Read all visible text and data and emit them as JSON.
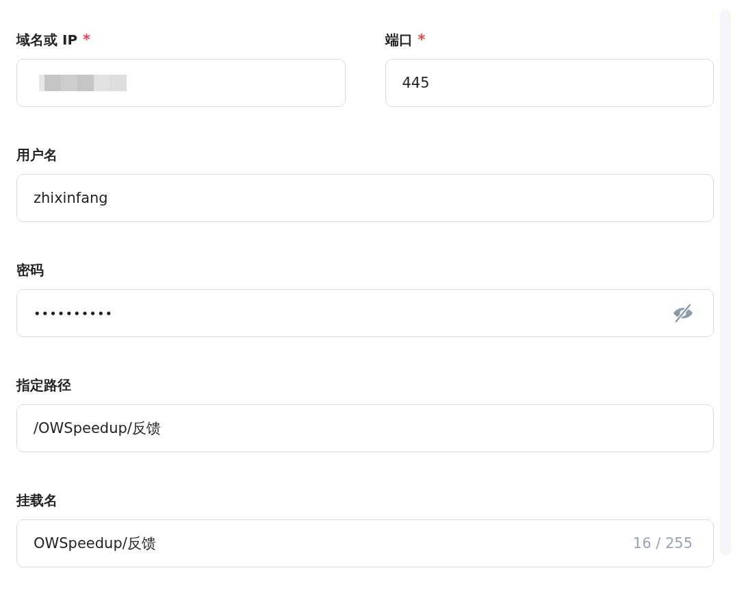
{
  "form": {
    "rows": [
      {
        "fields": [
          {
            "label": "域名或 IP",
            "required": true,
            "kind": "redacted"
          },
          {
            "label": "端口",
            "required": true,
            "kind": "text",
            "value": "445"
          }
        ]
      },
      {
        "fields": [
          {
            "label": "用户名",
            "required": false,
            "kind": "text",
            "value": "zhixinfang"
          }
        ]
      },
      {
        "fields": [
          {
            "label": "密码",
            "required": false,
            "kind": "password",
            "value": "••••••••••",
            "revealed": false
          }
        ]
      },
      {
        "fields": [
          {
            "label": "指定路径",
            "required": false,
            "kind": "text",
            "value": "/OWSpeedup/反馈"
          }
        ]
      },
      {
        "fields": [
          {
            "label": "挂载名",
            "required": false,
            "kind": "text",
            "value": "OWSpeedup/反馈",
            "counter": "16 / 255"
          }
        ]
      }
    ]
  },
  "required_mark": "*"
}
